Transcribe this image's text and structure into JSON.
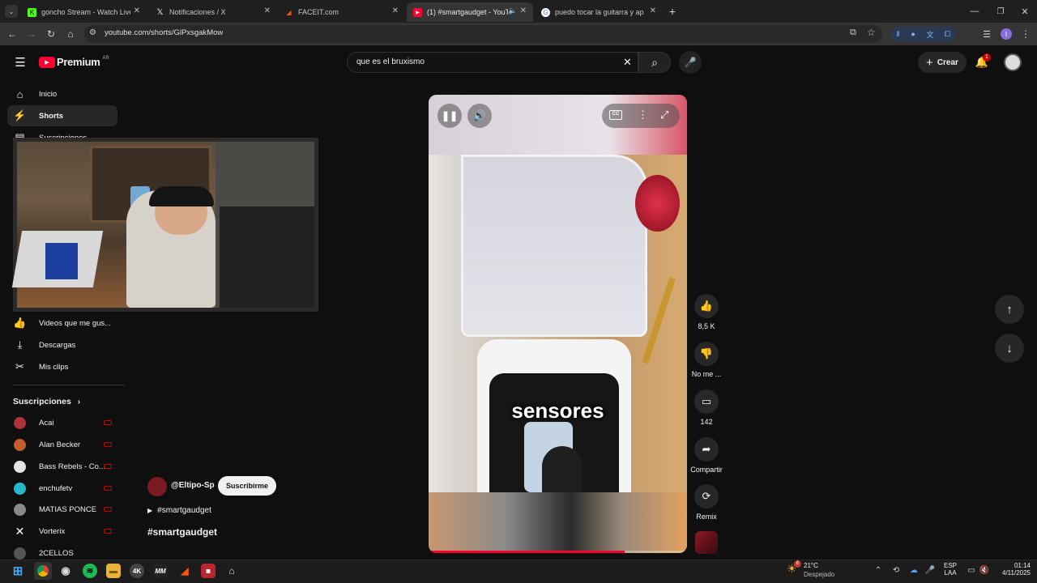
{
  "browser": {
    "tabs": [
      {
        "title": "goncho Stream - Watch Live on",
        "icon": "kick-icon",
        "color": "#53fc18"
      },
      {
        "title": "Notificaciones / X",
        "icon": "x-icon",
        "color": "#ffffff"
      },
      {
        "title": "FACEIT.com",
        "icon": "faceit-icon",
        "color": "#ff5500"
      },
      {
        "title": "(1) #smartgaudget - YouTu",
        "icon": "youtube-icon",
        "color": "#ff0033"
      },
      {
        "title": "puedo tocar la guitarra y apren",
        "icon": "google-icon",
        "color": "#4285f4"
      }
    ],
    "url": "youtube.com/shorts/GlPxsgakMow"
  },
  "youtube": {
    "logo_text": "Premium",
    "logo_region": "AR",
    "search_value": "que es el bruxismo",
    "create_label": "Crear",
    "notification_count": "1"
  },
  "sidebar": {
    "items": [
      {
        "label": "Inicio",
        "icon": "home-icon"
      },
      {
        "label": "Shorts",
        "icon": "shorts-icon"
      },
      {
        "label": "Suscripciones",
        "icon": "subscriptions-icon"
      }
    ],
    "lower_items": [
      {
        "label": "Videos que me gus...",
        "icon": "like-icon"
      },
      {
        "label": "Descargas",
        "icon": "download-icon"
      },
      {
        "label": "Mis clips",
        "icon": "scissors-icon"
      }
    ],
    "subs_header": "Suscripciones",
    "subs": [
      {
        "name": "Acai",
        "color": "#b0333a"
      },
      {
        "name": "Alan Becker",
        "color": "#c45c2b"
      },
      {
        "name": "Bass Rebels - Co...",
        "color": "#e5e5e5"
      },
      {
        "name": "enchufetv",
        "color": "#29b6c9"
      },
      {
        "name": "MATIAS PONCE",
        "color": "#888888"
      },
      {
        "name": "Vorterix",
        "color": "#ffffff"
      },
      {
        "name": "2CELLOS",
        "color": "#555555"
      }
    ]
  },
  "short": {
    "caption": "sensores",
    "channel": "@Eltipo-Sp",
    "subscribe_label": "Suscribirme",
    "hashtag_link": "#smartgaudget",
    "title": "#smartgaudget",
    "likes": "8,5 K",
    "dislike_label": "No me ...",
    "comments": "142",
    "share_label": "Compartir",
    "remix_label": "Remix",
    "progress": 0.76
  },
  "taskbar": {
    "weather_temp": "21°C",
    "weather_desc": "Despejado",
    "weather_badge": "6",
    "lang_top": "ESP",
    "lang_bottom": "LAA",
    "time": "01:14",
    "date": "4/11/2025",
    "app_labels": [
      "4K",
      "MM"
    ]
  }
}
